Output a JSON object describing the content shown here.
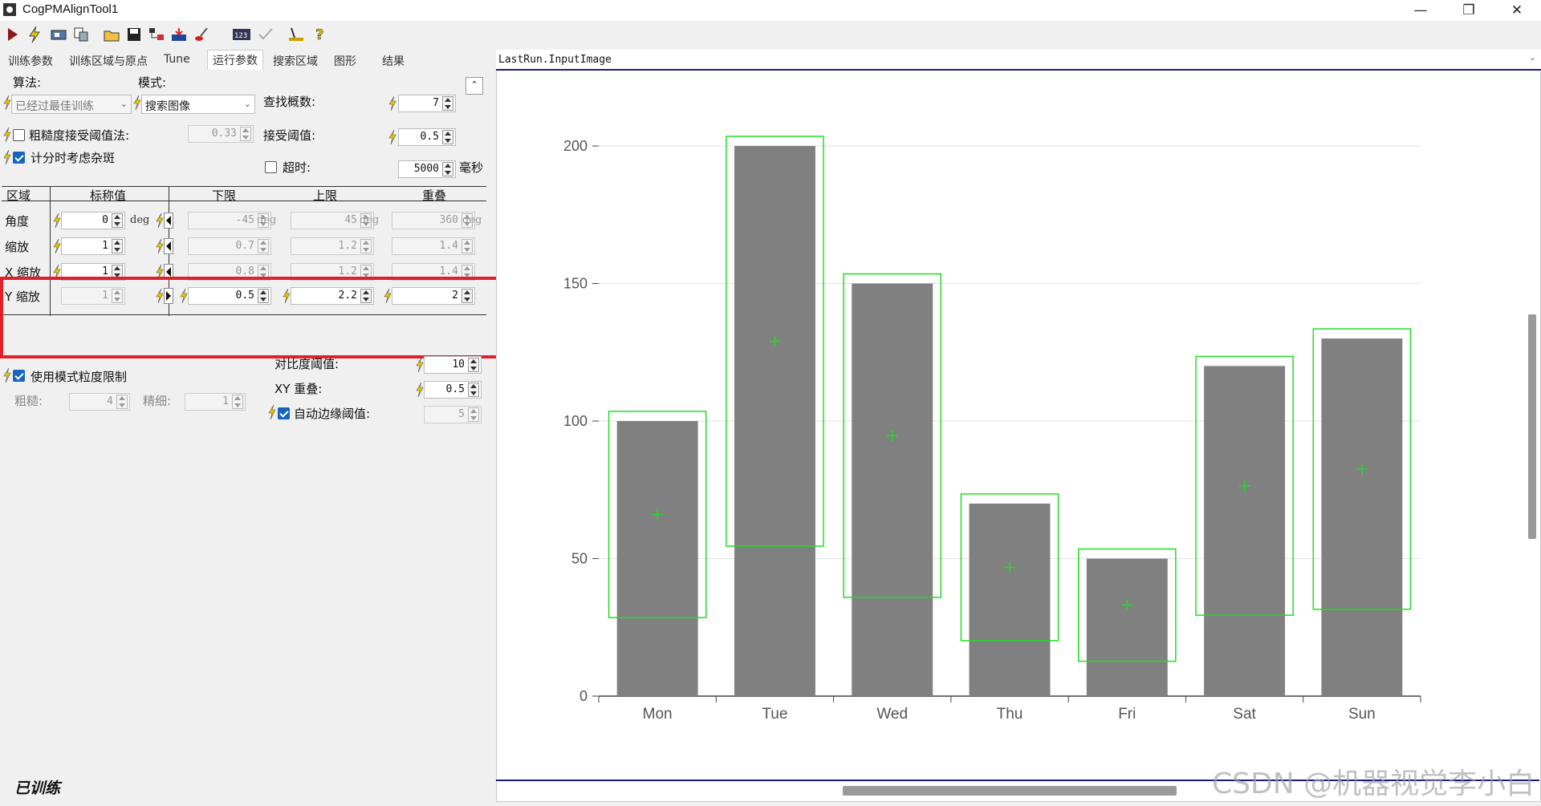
{
  "window": {
    "title": "CogPMAlignTool1",
    "controls": [
      "—",
      "❐",
      "✕"
    ]
  },
  "toolbar": {
    "icons": [
      "run-icon",
      "electric-icon",
      "camera-icon",
      "copy-icon",
      "open-icon",
      "save-icon",
      "tree-icon",
      "import-icon",
      "brush-icon",
      "counter-icon",
      "check-icon",
      "ruler-icon",
      "help-icon"
    ]
  },
  "tabs": [
    "训练参数",
    "训练区域与原点",
    "Tune",
    "运行参数",
    "搜索区域",
    "图形",
    "结果"
  ],
  "active_tab": "运行参数",
  "params": {
    "algorithm_label": "算法:",
    "mode_label": "模式:",
    "algorithm_value": "已经过最佳训练",
    "mode_value": "搜索图像",
    "find_count_label": "查找概数:",
    "find_count": "7",
    "coarse_accept_label": "粗糙度接受阈值法:",
    "coarse_accept_value": "0.33",
    "accept_threshold_label": "接受阈值:",
    "accept_threshold": "0.5",
    "clutter_label": "计分时考虑杂斑",
    "timeout_label": "超时:",
    "timeout_value": "5000",
    "timeout_unit": "毫秒"
  },
  "dof_table": {
    "headers": [
      "区域",
      "标称值",
      "下限",
      "上限",
      "重叠"
    ],
    "rows": [
      {
        "name": "角度",
        "nominal": "0",
        "unit": "deg",
        "low": "-45",
        "high": "45",
        "overlap": "360",
        "zone": false
      },
      {
        "name": "缩放",
        "nominal": "1",
        "unit": "",
        "low": "0.7",
        "high": "1.2",
        "overlap": "1.4",
        "zone": false
      },
      {
        "name": "X 缩放",
        "nominal": "1",
        "unit": "",
        "low": "0.8",
        "high": "1.2",
        "overlap": "1.4",
        "zone": false
      },
      {
        "name": "Y 缩放",
        "nominal": "1",
        "unit": "",
        "low": "0.5",
        "high": "2.2",
        "overlap": "2",
        "zone": true
      }
    ]
  },
  "grain": {
    "use_label": "使用模式粒度限制",
    "coarse_label": "粗糙:",
    "coarse": "4",
    "fine_label": "精细:",
    "fine": "1",
    "contrast_label": "对比度阈值:",
    "contrast": "10",
    "xy_overlap_label": "XY 重叠:",
    "xy_overlap": "0.5",
    "auto_edge_label": "自动边缘阈值:",
    "auto_edge": "5"
  },
  "status": {
    "trained": "已训练"
  },
  "viewer": {
    "header": "LastRun.InputImage",
    "watermark": "CSDN @机器视觉李小白"
  },
  "chart_data": {
    "type": "bar",
    "categories": [
      "Mon",
      "Tue",
      "Wed",
      "Thu",
      "Fri",
      "Sat",
      "Sun"
    ],
    "values": [
      100,
      200,
      150,
      70,
      50,
      120,
      130
    ],
    "ylim": [
      0,
      200
    ],
    "yticks": [
      0,
      50,
      100,
      150,
      200
    ],
    "grid": true,
    "bar_color": "#808080",
    "overlay_color": "#22dd22"
  },
  "colors": {
    "accent": "#1565c0",
    "highlight": "#e0202a",
    "bolt": "#e6c800"
  }
}
